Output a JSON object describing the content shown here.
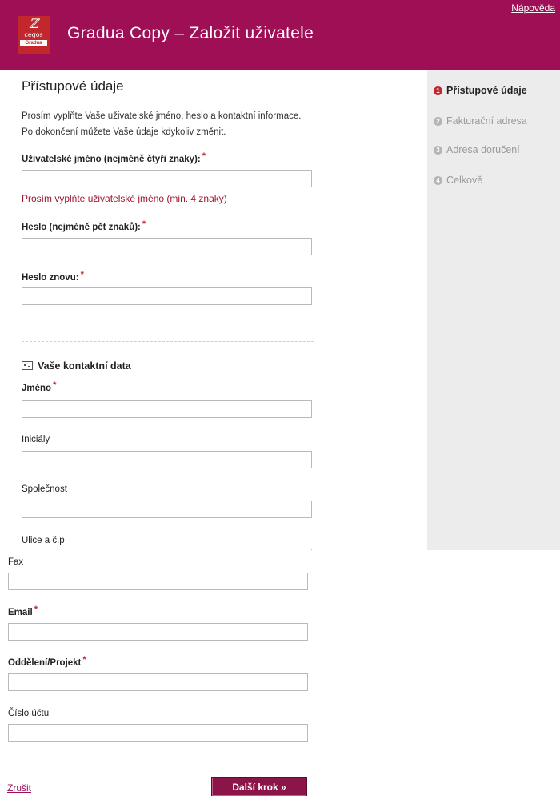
{
  "header": {
    "logo": {
      "brand": "cegos",
      "sub": "Gradua"
    },
    "title": "Gradua Copy – Založit uživatele",
    "help_link": "Nápověda"
  },
  "sidebar": {
    "steps": [
      {
        "number": "1",
        "label": "Přístupové údaje",
        "active": true
      },
      {
        "number": "2",
        "label": "Fakturační adresa",
        "active": false
      },
      {
        "number": "3",
        "label": "Adresa doručení",
        "active": false
      },
      {
        "number": "4",
        "label": "Celkově",
        "active": false
      }
    ]
  },
  "main": {
    "title": "Přístupové údaje",
    "intro_line1": "Prosím vyplňte Vaše uživatelské jméno, heslo a kontaktní informace.",
    "intro_line2": "Po dokončení můžete Vaše údaje kdykoliv změnit.",
    "username_label": "Uživatelské jméno (nejméně čtyři znaky):",
    "username_value": "",
    "username_error": "Prosím vyplňte uživatelské jméno (min. 4 znaky)",
    "password_label": "Heslo (nejméně pět znaků):",
    "password_value": "",
    "password_repeat_label": "Heslo znovu:",
    "password_repeat_value": "",
    "contact_section_title": "Vaše kontaktní data",
    "name_label": "Jméno",
    "name_value": "",
    "initials_label": "Iniciály",
    "initials_value": "",
    "company_label": "Společnost",
    "company_value": "",
    "street_label": "Ulice a č.p"
  },
  "lower": {
    "fax_label": "Fax",
    "fax_value": "",
    "email_label": "Email",
    "email_value": "",
    "department_label": "Oddělení/Projekt",
    "department_value": "",
    "account_label": "Číslo účtu",
    "account_value": "",
    "cancel_label": "Zrušit",
    "next_label": "Další krok »"
  },
  "required_marker": "*",
  "colors": {
    "brand": "#9e0f55",
    "accent": "#c1272d",
    "error": "#a0162f",
    "sidebar_bg": "#ececec"
  }
}
